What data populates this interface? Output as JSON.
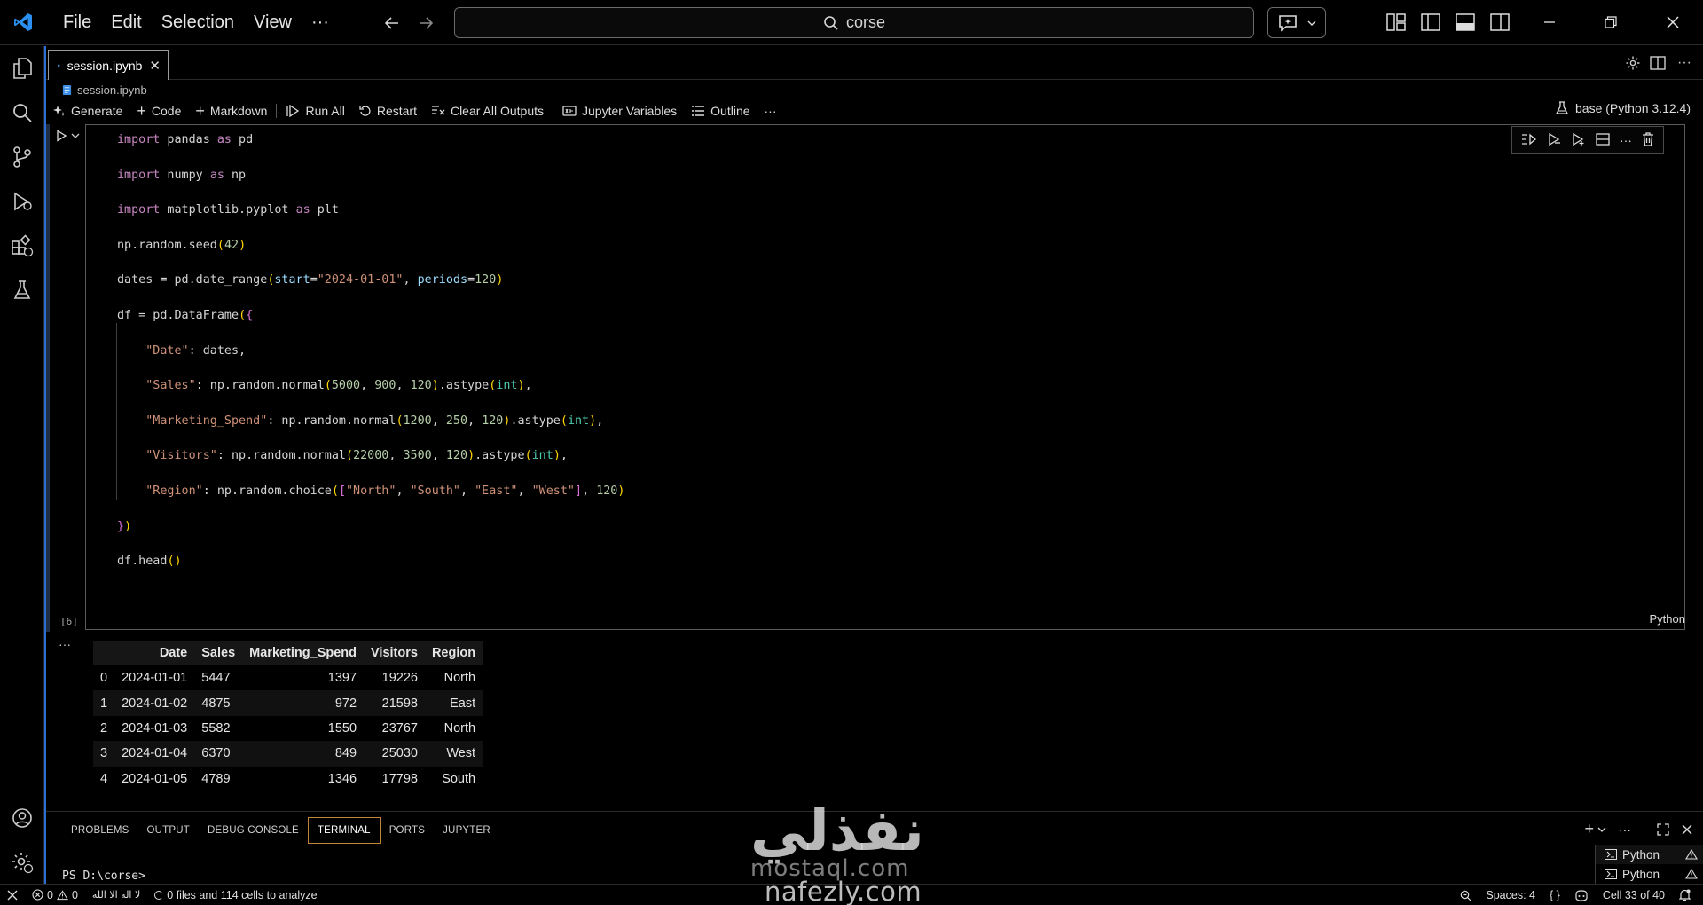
{
  "titlebar": {
    "menu": [
      "File",
      "Edit",
      "Selection",
      "View",
      "···"
    ],
    "search_text": "corse"
  },
  "tab": {
    "label": "session.ipynb",
    "close": "✕"
  },
  "breadcrumb": {
    "file": "session.ipynb"
  },
  "toolbar": {
    "generate": "Generate",
    "code": "Code",
    "markdown": "Markdown",
    "run_all": "Run All",
    "restart": "Restart",
    "clear_outputs": "Clear All Outputs",
    "variables": "Jupyter Variables",
    "outline": "Outline",
    "more": "···",
    "kernel": "base (Python 3.12.4)"
  },
  "cell": {
    "execution_count": "[6]",
    "language": "Python",
    "output_more": "···"
  },
  "output_table": {
    "columns": [
      "",
      "Date",
      "Sales",
      "Marketing_Spend",
      "Visitors",
      "Region"
    ],
    "rows": [
      [
        "0",
        "2024-01-01",
        "5447",
        "1397",
        "19226",
        "North"
      ],
      [
        "1",
        "2024-01-02",
        "4875",
        "972",
        "21598",
        "East"
      ],
      [
        "2",
        "2024-01-03",
        "5582",
        "1550",
        "23767",
        "North"
      ],
      [
        "3",
        "2024-01-04",
        "6370",
        "849",
        "25030",
        "West"
      ],
      [
        "4",
        "2024-01-05",
        "4789",
        "1346",
        "17798",
        "South"
      ]
    ]
  },
  "panel": {
    "tabs": [
      "PROBLEMS",
      "OUTPUT",
      "DEBUG CONSOLE",
      "TERMINAL",
      "PORTS",
      "JUPYTER"
    ],
    "active_tab": "TERMINAL",
    "prompt": "PS D:\\corse>",
    "terminals": [
      "Python",
      "Python"
    ]
  },
  "statusbar": {
    "errors": "0",
    "warnings": "0",
    "arabic_text": "لا اله الا الله",
    "analysis": "0 files and 114 cells to analyze",
    "spaces": "Spaces: 4",
    "braces": "{ }",
    "cell_pos": "Cell 33 of 40"
  },
  "watermark": {
    "arabic": "نفذلي",
    "line1": "mostaql.com",
    "line2": "nafezly.com"
  },
  "colors": {
    "accent": "#2b6fd6",
    "active_tab_border": "#c0843a",
    "keyword": "#c586c0",
    "string": "#ce9178",
    "number": "#b5cea8"
  }
}
